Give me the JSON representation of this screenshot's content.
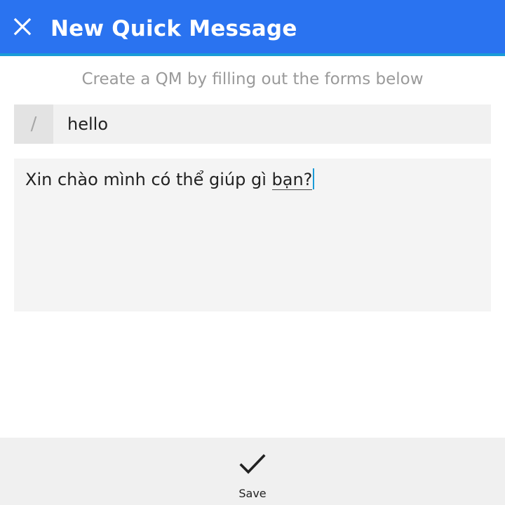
{
  "header": {
    "title": "New Quick Message",
    "background": "#2a73f0",
    "accent": "#1a9bd7",
    "close_icon": "close-icon"
  },
  "form": {
    "instructions": "Create a QM by filling out the forms below",
    "shortcut_prefix": "/",
    "shortcut_value": "hello",
    "message_before": "Xin chào mình có thể giúp gì ",
    "message_underlined_word": "bạn?"
  },
  "actions": {
    "save_label": "Save",
    "save_icon": "checkmark-icon"
  }
}
